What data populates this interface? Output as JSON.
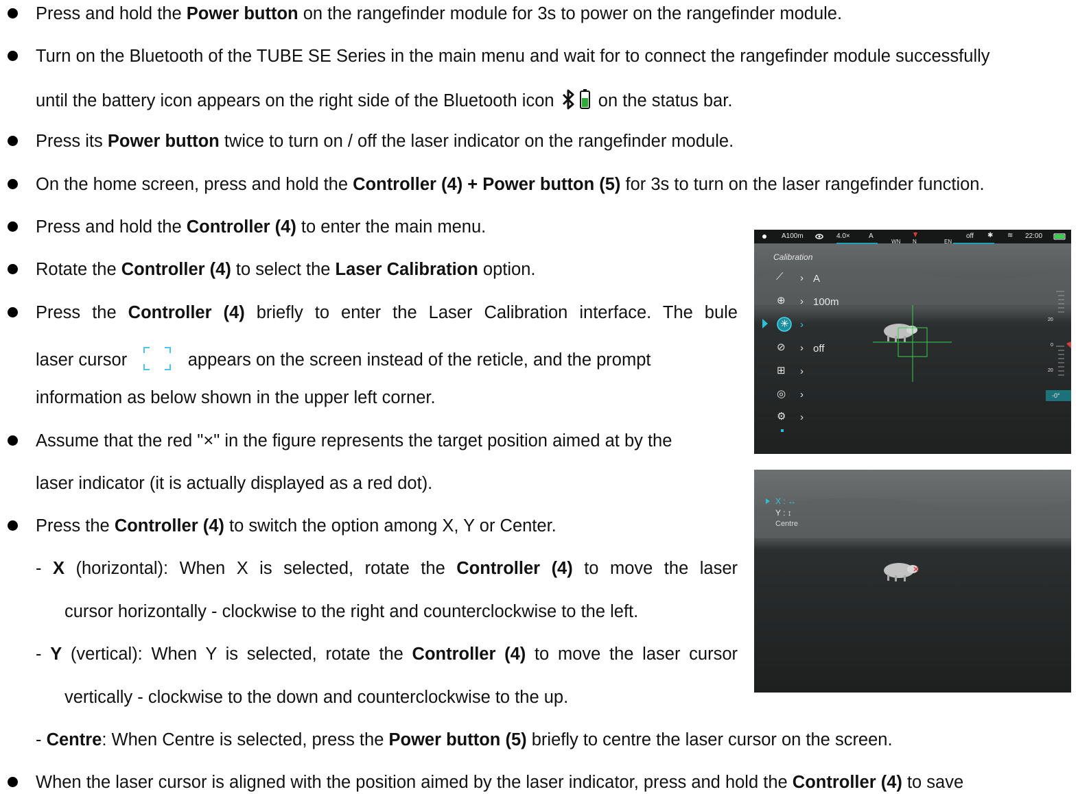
{
  "lines": {
    "l1_a": "Press and hold the ",
    "l1_b": "Power button",
    "l1_c": " on the rangefinder module for 3s to power on the rangefinder module.",
    "l2": "Turn on the Bluetooth of the TUBE SE Series in the main menu and wait for to connect the rangefinder module successfully",
    "l3_a": "until the battery icon appears on the right side of the Bluetooth icon",
    "l3_b": "on the status bar.",
    "l4_a": "Press its ",
    "l4_b": "Power button",
    "l4_c": " twice to turn on / off the laser indicator on the rangefinder module.",
    "l5_a": "On the home screen, press and hold the ",
    "l5_b": "Controller (4) + Power button (5)",
    "l5_c": " for 3s to turn on the laser rangefinder function.",
    "l6_a": "Press and hold the ",
    "l6_b": "Controller (4)",
    "l6_c": " to enter the main menu.",
    "l7_a": "Rotate the ",
    "l7_b": "Controller (4)",
    "l7_c": " to select the ",
    "l7_d": "Laser Calibration",
    "l7_e": " option.",
    "l8_a": "Press the ",
    "l8_b": "Controller (4)",
    "l8_c": " briefly to enter the Laser Calibration interface. The bule",
    "l9_a": "laser cursor",
    "l9_b": "appears on the screen instead of the reticle, and the prompt",
    "l10": "information as below shown in the upper left corner.",
    "l11": "Assume that the red \"×\" in the figure represents the target position aimed at by the",
    "l12": "laser indicator (it is actually displayed as a red dot).",
    "l13_a": "Press the ",
    "l13_b": "Controller (4)",
    "l13_c": " to switch the option among X, Y or Center.",
    "l14_a": "- ",
    "l14_b": "X",
    "l14_c": " (horizontal): When X is selected, rotate the ",
    "l14_d": "Controller (4)",
    "l14_e": " to move the laser",
    "l15": "cursor horizontally - clockwise to the right and counterclockwise to the left.",
    "l16_a": "- ",
    "l16_b": "Y",
    "l16_c": " (vertical): When Y is selected, rotate the ",
    "l16_d": "Controller (4)",
    "l16_e": " to move the laser cursor",
    "l17": "vertically - clockwise to the down and counterclockwise to the up.",
    "l18_a": "- ",
    "l18_b": "Centre",
    "l18_c": ": When Centre is selected, press the ",
    "l18_d": "Power button (5)",
    "l18_e": " briefly to centre the laser cursor on the screen.",
    "l19_a": "When the laser cursor is aligned with the position aimed by the laser indicator, press and hold the ",
    "l19_b": "Controller (4)",
    "l19_c": " to save"
  },
  "screen1": {
    "status": {
      "range": "A100m",
      "zoom": "4.0×",
      "mode": "A",
      "compass_left": "WN",
      "compass_mid": "N",
      "compass_right": "EN",
      "display": "off",
      "time": "22:00"
    },
    "menu_title": "Calibration",
    "menu_items": [
      {
        "icon": "rifle-icon",
        "value": "A"
      },
      {
        "icon": "crosshair-icon",
        "value": "100m"
      },
      {
        "icon": "laser-calibration-icon",
        "value": ""
      },
      {
        "icon": "display-off-icon",
        "value": "off"
      },
      {
        "icon": "add-box-icon",
        "value": ""
      },
      {
        "icon": "compass-icon",
        "value": ""
      },
      {
        "icon": "settings-gear-icon",
        "value": ""
      }
    ],
    "scale": {
      "top": "20",
      "mid": "0",
      "bottom": "20",
      "angle": "-0°"
    }
  },
  "screen2": {
    "options": [
      "X : ↔",
      "Y : ↕",
      "Centre"
    ]
  }
}
